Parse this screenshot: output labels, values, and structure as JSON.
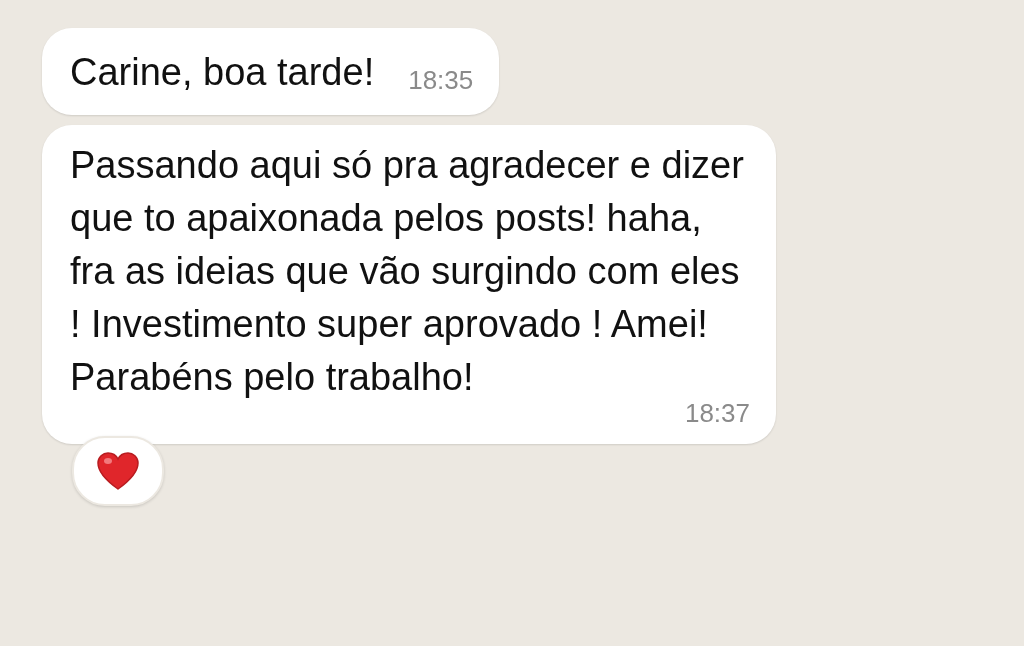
{
  "messages": [
    {
      "text": "Carine, boa tarde!",
      "time": "18:35"
    },
    {
      "text": "Passando aqui só pra agradecer e dizer que to apaixonada pelos posts! haha, fra as ideias que vão surgindo com eles ! Investimento super aprovado ! Amei! Parabéns pelo trabalho!",
      "time": "18:37",
      "reactions": [
        {
          "kind": "heart"
        }
      ]
    }
  ]
}
